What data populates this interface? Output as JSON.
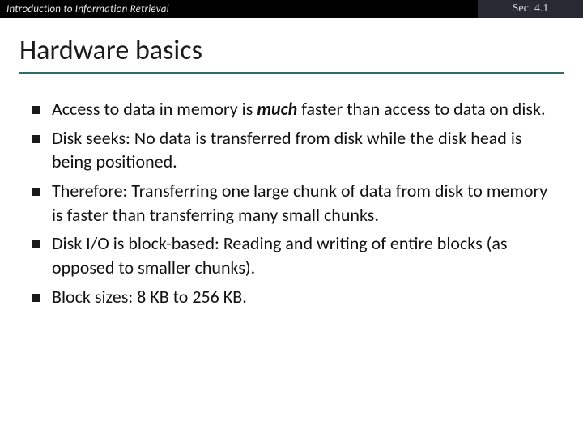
{
  "header": {
    "course": "Introduction to Information Retrieval",
    "section": "Sec. 4.1"
  },
  "title": "Hardware basics",
  "bullets": [
    {
      "pre": "Access to data in memory is ",
      "em": "much",
      "post": " faster than access to data on disk."
    },
    {
      "pre": "Disk seeks: No data is transferred from disk while the disk head is being positioned.",
      "em": "",
      "post": ""
    },
    {
      "pre": "Therefore: Transferring one large chunk of data from disk to memory is faster than transferring many small chunks.",
      "em": "",
      "post": ""
    },
    {
      "pre": "Disk I/O is block-based: Reading and writing of entire blocks (as opposed to smaller chunks).",
      "em": "",
      "post": ""
    },
    {
      "pre": "Block sizes: 8 KB to 256 KB.",
      "em": "",
      "post": ""
    }
  ]
}
